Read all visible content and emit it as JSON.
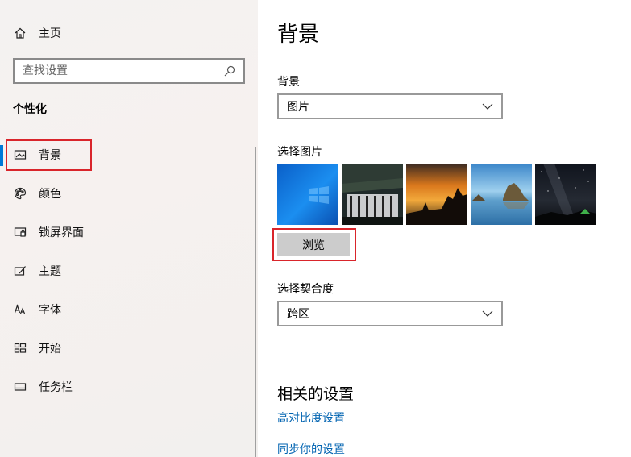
{
  "sidebar": {
    "home_label": "主页",
    "search_placeholder": "查找设置",
    "section_title": "个性化",
    "items": [
      {
        "label": "背景",
        "icon": "image-icon"
      },
      {
        "label": "颜色",
        "icon": "palette-icon"
      },
      {
        "label": "锁屏界面",
        "icon": "lock-screen-icon"
      },
      {
        "label": "主题",
        "icon": "theme-brush-icon"
      },
      {
        "label": "字体",
        "icon": "font-icon"
      },
      {
        "label": "开始",
        "icon": "start-icon"
      },
      {
        "label": "任务栏",
        "icon": "taskbar-icon"
      }
    ]
  },
  "main": {
    "title": "背景",
    "background_label": "背景",
    "background_value": "图片",
    "choose_picture_label": "选择图片",
    "browse_label": "浏览",
    "fit_label": "选择契合度",
    "fit_value": "跨区",
    "related_title": "相关的设置",
    "links": [
      "高对比度设置",
      "同步你的设置"
    ]
  },
  "colors": {
    "accent": "#0078d7",
    "highlight_box": "#d9252b",
    "link": "#0063b1"
  }
}
